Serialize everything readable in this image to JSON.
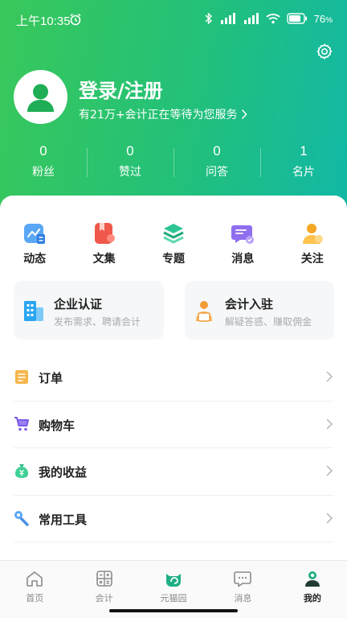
{
  "status_bar": {
    "time": "上午10:35",
    "battery": "76"
  },
  "profile": {
    "login_title": "登录/注册",
    "login_subtitle": "有21万+会计正在等待为您服务"
  },
  "stats": [
    {
      "value": "0",
      "label": "粉丝"
    },
    {
      "value": "0",
      "label": "赞过"
    },
    {
      "value": "0",
      "label": "问答"
    },
    {
      "value": "1",
      "label": "名片"
    }
  ],
  "quick_actions": [
    {
      "label": "动态",
      "icon": "trend-chart-icon"
    },
    {
      "label": "文集",
      "icon": "book-icon"
    },
    {
      "label": "专题",
      "icon": "layers-icon"
    },
    {
      "label": "消息",
      "icon": "message-icon"
    },
    {
      "label": "关注",
      "icon": "person-icon"
    }
  ],
  "promos": [
    {
      "title": "企业认证",
      "subtitle": "发布需求、聘请会计",
      "icon": "building-icon"
    },
    {
      "title": "会计入驻",
      "subtitle": "解疑答惑、赚取佣金",
      "icon": "accountant-icon"
    }
  ],
  "menu": [
    {
      "label": "订单",
      "icon": "order-icon"
    },
    {
      "label": "购物车",
      "icon": "cart-icon"
    },
    {
      "label": "我的收益",
      "icon": "money-bag-icon"
    },
    {
      "label": "常用工具",
      "icon": "wrench-icon"
    }
  ],
  "tabs": [
    {
      "label": "首页",
      "icon": "home-icon"
    },
    {
      "label": "会计",
      "icon": "calculator-icon"
    },
    {
      "label": "元猫园",
      "icon": "cat-park-icon"
    },
    {
      "label": "消息",
      "icon": "chat-icon"
    },
    {
      "label": "我的",
      "icon": "profile-icon",
      "active": true
    }
  ],
  "colors": {
    "brand_green": "#22c07a",
    "gradient_start": "#39c85a",
    "gradient_end": "#12b8a6"
  }
}
